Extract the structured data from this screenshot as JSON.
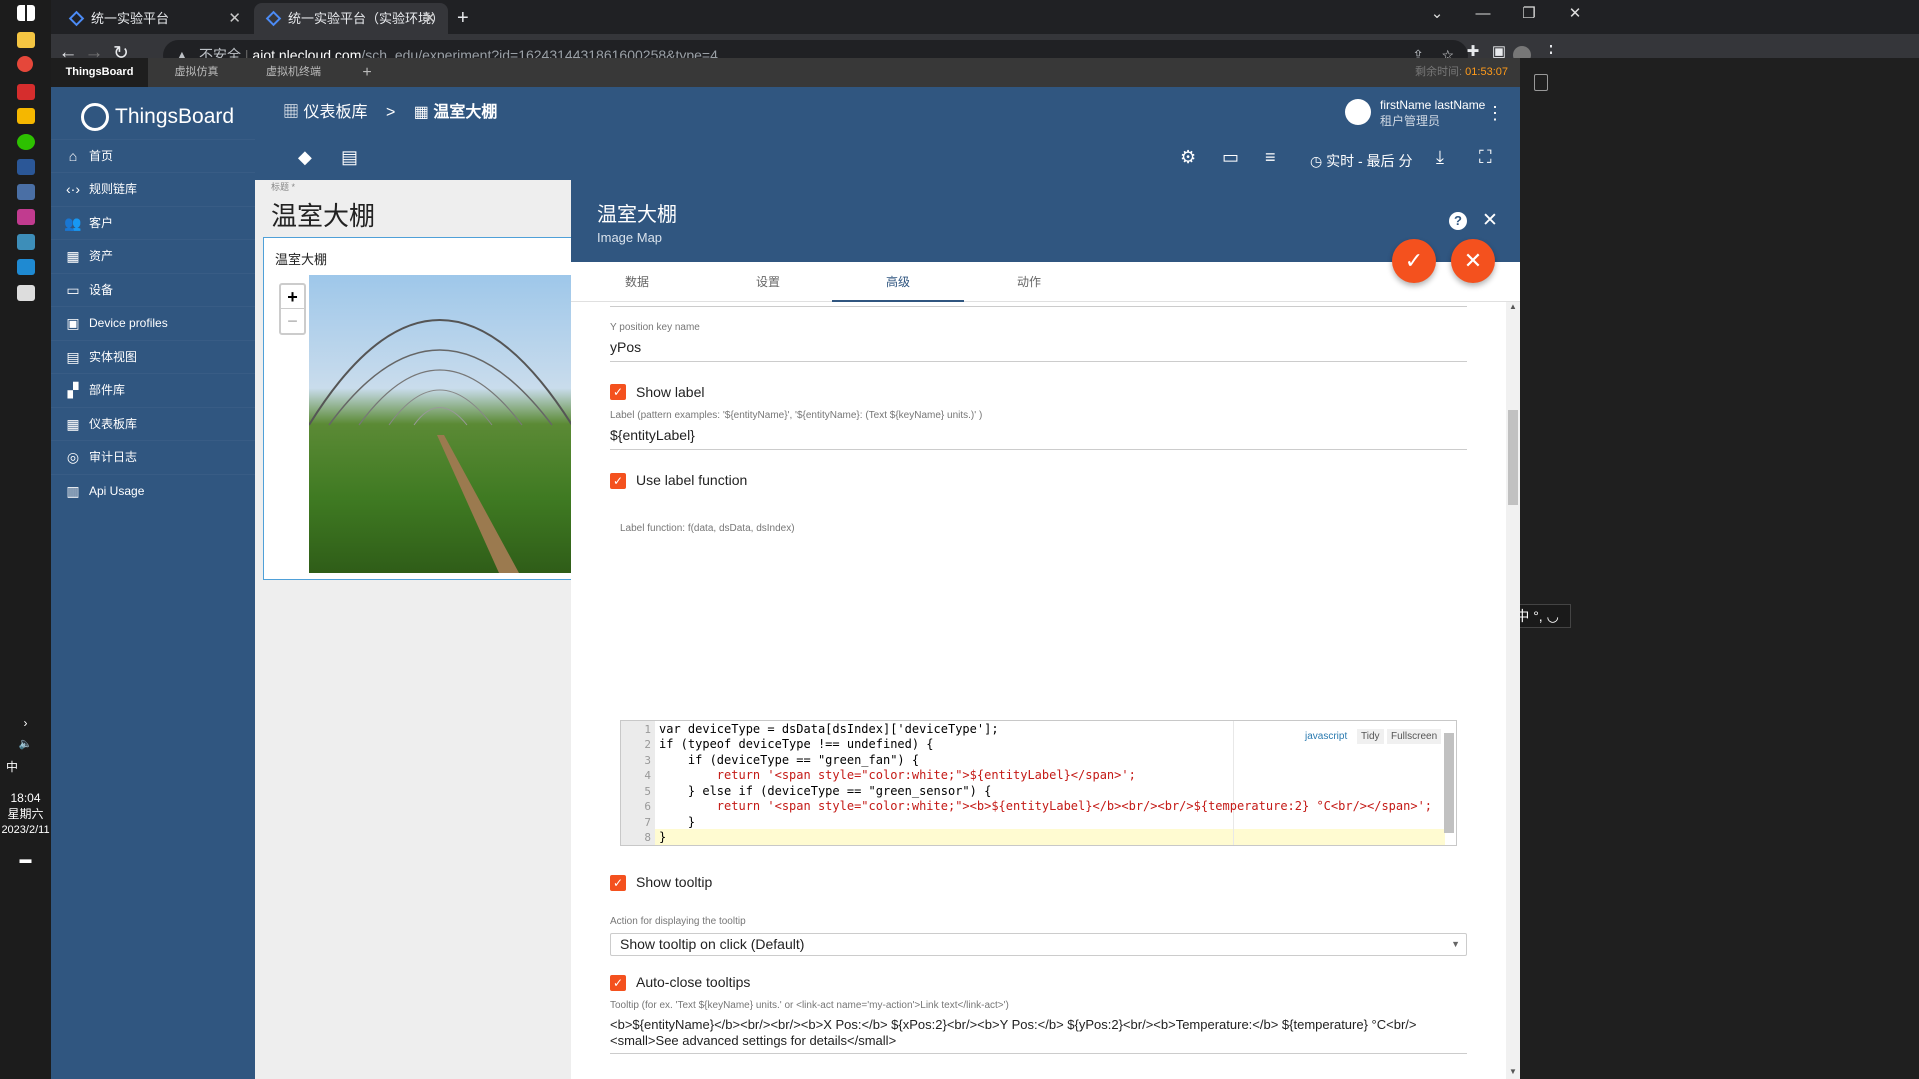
{
  "taskbar": {
    "time": "18:04",
    "weekday": "星期六",
    "date": "2023/2/11",
    "ime": "中"
  },
  "browser": {
    "tabs": [
      {
        "title": "统一实验平台"
      },
      {
        "title": "统一实验平台（实验环境）"
      }
    ],
    "url_warning": "不安全",
    "url_host": "aiot.nlecloud.com",
    "url_path": "/sch_edu/experiment?id=1624314431861600258&type=4"
  },
  "app_tabs": {
    "items": [
      "ThingsBoard",
      "虚拟仿真",
      "虚拟机终端"
    ],
    "timer_label": "剩余时间:",
    "timer_value": "01:53:07"
  },
  "sidebar": {
    "logo": "ThingsBoard",
    "items": [
      {
        "label": "首页",
        "icon": "home-icon"
      },
      {
        "label": "规则链库",
        "icon": "code-icon"
      },
      {
        "label": "客户",
        "icon": "people-icon"
      },
      {
        "label": "资产",
        "icon": "building-icon"
      },
      {
        "label": "设备",
        "icon": "devices-icon"
      },
      {
        "label": "Device profiles",
        "icon": "profile-icon"
      },
      {
        "label": "实体视图",
        "icon": "view-icon"
      },
      {
        "label": "部件库",
        "icon": "widgets-icon"
      },
      {
        "label": "仪表板库",
        "icon": "dashboard-icon"
      },
      {
        "label": "审计日志",
        "icon": "track-icon"
      },
      {
        "label": "Api Usage",
        "icon": "chart-icon"
      }
    ]
  },
  "header": {
    "breadcrumb_root": "仪表板库",
    "breadcrumb_sep": ">",
    "breadcrumb_current": "温室大棚",
    "user_name": "firstName lastName",
    "user_role": "租户管理员",
    "timewindow": "实时 - 最后 分"
  },
  "dashboard": {
    "title_label": "标题 *",
    "title": "温室大棚",
    "widget_title": "温室大棚",
    "zoom_in": "+",
    "zoom_out": "−"
  },
  "panel": {
    "title": "温室大棚",
    "subtitle": "Image Map",
    "tabs": [
      "数据",
      "设置",
      "高级",
      "动作"
    ],
    "active_tab": "高级",
    "fields": {
      "ypos_label": "Y position key name",
      "ypos_value": "yPos",
      "show_label": "Show label",
      "label_pattern_label": "Label (pattern examples: '${entityName}', '${entityName}: (Text ${keyName} units.)' )",
      "label_pattern_value": "${entityLabel}",
      "use_label_function": "Use label function",
      "label_function_label": "Label function: f(data, dsData, dsIndex)",
      "show_tooltip": "Show tooltip",
      "tooltip_action_label": "Action for displaying the tooltip",
      "tooltip_action_value": "Show tooltip on click (Default)",
      "auto_close": "Auto-close tooltips",
      "tooltip_pattern_label": "Tooltip (for ex. 'Text ${keyName} units.' or <link-act name='my-action'>Link text</link-act>')",
      "tooltip_pattern_line1": "<b>${entityName}</b><br/><br/><b>X Pos:</b> ${xPos:2}<br/><b>Y Pos:</b> ${yPos:2}<br/><b>Temperature:</b> ${temperature} °C<br/>",
      "tooltip_pattern_line2": "<small>See advanced settings for details</small>"
    },
    "editor": {
      "mode": "javascript",
      "tidy": "Tidy",
      "fullscreen": "Fullscreen",
      "lines": [
        "var deviceType = dsData[dsIndex]['deviceType'];",
        "if (typeof deviceType !== undefined) {",
        "    if (deviceType == \"green_fan\") {",
        "        return '<span style=\"color:white;\">${entityLabel}</span>';",
        "    } else if (deviceType == \"green_sensor\") {",
        "        return '<span style=\"color:white;\"><b>${entityLabel}</b><br/><br/>${temperature:2} °C<br/></span>';",
        "    }",
        "}"
      ]
    }
  }
}
